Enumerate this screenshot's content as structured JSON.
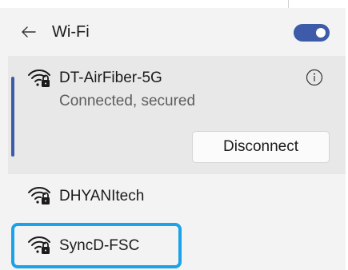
{
  "header": {
    "back_icon": "arrow-left-icon",
    "title": "Wi-Fi",
    "toggle_state": "on"
  },
  "connected_network": {
    "name": "DT-AirFiber-5G",
    "status": "Connected, secured",
    "icon": "wifi-secured-icon",
    "info_icon": "info-icon",
    "disconnect_label": "Disconnect"
  },
  "networks": [
    {
      "name": "DHYANItech",
      "icon": "wifi-secured-icon"
    },
    {
      "name": "SyncD-FSC",
      "icon": "wifi-secured-icon",
      "highlighted": true
    }
  ],
  "colors": {
    "accent": "#3d5ba9",
    "highlight": "#1aa3e8",
    "panel_bg": "#f3f3f3",
    "selected_bg": "#e8e8e8"
  }
}
